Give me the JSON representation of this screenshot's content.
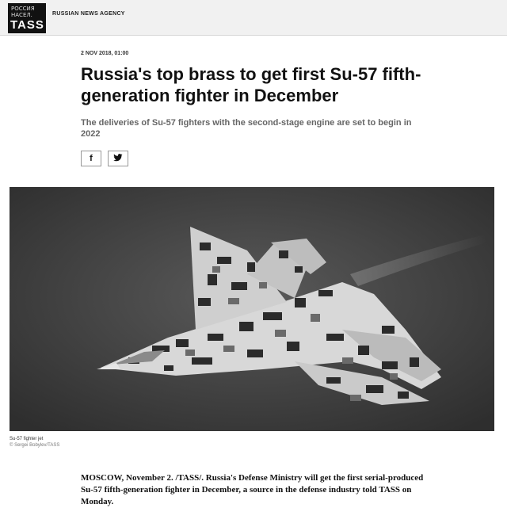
{
  "header": {
    "logo_small": "РОССИЯ НАСЕЛ.",
    "logo_main": "TASS",
    "agency": "RUSSIAN NEWS AGENCY"
  },
  "article": {
    "meta": "2 NOV 2018, 01:00",
    "title": "Russia's top brass to get first Su-57 fifth-generation fighter in December",
    "lead": "The deliveries of Su-57 fighters with the second-stage engine are set to begin in 2022",
    "share": {
      "facebook_icon": "f",
      "twitter_icon": "🐦"
    },
    "photo": {
      "caption": "Su-57 fighter jet",
      "credit": "© Sergei Bobylev/TASS"
    },
    "body": "MOSCOW, November 2. /TASS/. Russia's Defense Ministry will get the first serial-produced Su-57 fifth-generation fighter in December, a source in the defense industry told TASS on Monday."
  }
}
